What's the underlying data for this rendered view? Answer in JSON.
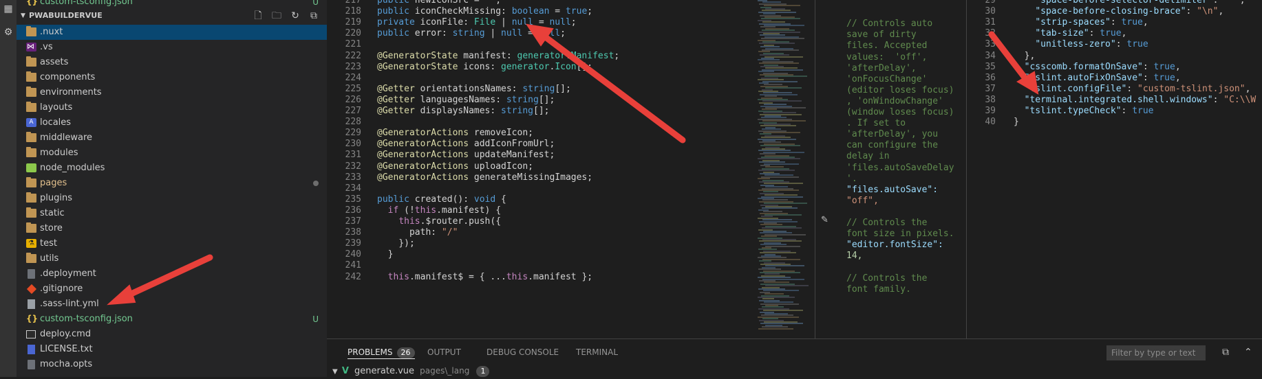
{
  "explorer": {
    "top_file": "custom-tsconfig.json",
    "top_file_badge": "U",
    "section_title": "PWABUILDERVUE",
    "items": [
      {
        "label": ".nuxt",
        "icon": "folder-icon",
        "selected": true
      },
      {
        "label": ".vs",
        "icon": "visual-studio-icon"
      },
      {
        "label": "assets",
        "icon": "folder-icon"
      },
      {
        "label": "components",
        "icon": "folder-icon"
      },
      {
        "label": "environments",
        "icon": "folder-icon"
      },
      {
        "label": "layouts",
        "icon": "folder-icon"
      },
      {
        "label": "locales",
        "icon": "locale-folder-icon"
      },
      {
        "label": "middleware",
        "icon": "folder-icon"
      },
      {
        "label": "modules",
        "icon": "folder-icon"
      },
      {
        "label": "node_modules",
        "icon": "node-folder-icon"
      },
      {
        "label": "pages",
        "icon": "folder-icon",
        "modified": true
      },
      {
        "label": "plugins",
        "icon": "folder-icon"
      },
      {
        "label": "static",
        "icon": "folder-icon"
      },
      {
        "label": "store",
        "icon": "folder-icon"
      },
      {
        "label": "test",
        "icon": "test-folder-icon"
      },
      {
        "label": "utils",
        "icon": "folder-icon"
      },
      {
        "label": ".deployment",
        "icon": "file-icon"
      },
      {
        "label": ".gitignore",
        "icon": "git-icon"
      },
      {
        "label": ".sass-lint.yml",
        "icon": "sass-icon"
      },
      {
        "label": "custom-tsconfig.json",
        "icon": "json-icon",
        "badge": "U"
      },
      {
        "label": "deploy.cmd",
        "icon": "cmd-icon"
      },
      {
        "label": "LICENSE.txt",
        "icon": "text-file-icon"
      },
      {
        "label": "mocha.opts",
        "icon": "file-icon"
      }
    ]
  },
  "editor1": {
    "lines": [
      {
        "n": "217",
        "t": "public newIconSrc = \"\";"
      },
      {
        "n": "218",
        "t": "public iconCheckMissing: boolean = true;"
      },
      {
        "n": "219",
        "t": "private iconFile: File | null = null;"
      },
      {
        "n": "220",
        "t": "public error: string | null = null;"
      },
      {
        "n": "221",
        "t": ""
      },
      {
        "n": "222",
        "t": "@GeneratorState manifest: generator.Manifest;"
      },
      {
        "n": "223",
        "t": "@GeneratorState icons: generator.Icon[];"
      },
      {
        "n": "224",
        "t": ""
      },
      {
        "n": "225",
        "t": "@Getter orientationsNames: string[];"
      },
      {
        "n": "226",
        "t": "@Getter languagesNames: string[];"
      },
      {
        "n": "227",
        "t": "@Getter displaysNames: string[];"
      },
      {
        "n": "228",
        "t": ""
      },
      {
        "n": "229",
        "t": "@GeneratorActions removeIcon;"
      },
      {
        "n": "230",
        "t": "@GeneratorActions addIconFromUrl;"
      },
      {
        "n": "231",
        "t": "@GeneratorActions updateManifest;"
      },
      {
        "n": "232",
        "t": "@GeneratorActions uploadIcon;"
      },
      {
        "n": "233",
        "t": "@GeneratorActions generateMissingImages;"
      },
      {
        "n": "234",
        "t": ""
      },
      {
        "n": "235",
        "t": "public created(): void {"
      },
      {
        "n": "236",
        "t": "  if (!this.manifest) {"
      },
      {
        "n": "237",
        "t": "    this.$router.push({"
      },
      {
        "n": "238",
        "t": "      path: \"/\""
      },
      {
        "n": "239",
        "t": "    });"
      },
      {
        "n": "240",
        "t": "  }"
      },
      {
        "n": "241",
        "t": ""
      },
      {
        "n": "242",
        "t": "  this.manifest$ = { ...this.manifest };"
      }
    ]
  },
  "editor2": {
    "lines": [
      "",
      "",
      "// Controls auto",
      "save of dirty",
      "files. Accepted",
      "values:  'off',",
      "'afterDelay',",
      "'onFocusChange'",
      "(editor loses focus)",
      ", 'onWindowChange'",
      "(window loses focus)",
      ". If set to",
      "'afterDelay', you",
      "can configure the",
      "delay in",
      "'files.autoSaveDelay",
      "'.",
      "\"files.autoSave\":",
      "\"off\",",
      "",
      "// Controls the",
      "font size in pixels.",
      "\"editor.fontSize\":",
      "14,",
      "",
      "// Controls the",
      "font family."
    ]
  },
  "editor3": {
    "lines": [
      {
        "n": "29",
        "t": "    \"space-before-selector-delimiter\": \" \","
      },
      {
        "n": "30",
        "t": "    \"space-before-closing-brace\": \"\\n\","
      },
      {
        "n": "31",
        "t": "    \"strip-spaces\": true,"
      },
      {
        "n": "32",
        "t": "    \"tab-size\": true,"
      },
      {
        "n": "33",
        "t": "    \"unitless-zero\": true"
      },
      {
        "n": "34",
        "t": "  },"
      },
      {
        "n": "35",
        "t": "  \"csscomb.formatOnSave\": true,"
      },
      {
        "n": "36",
        "t": "  \"tslint.autoFixOnSave\": true,"
      },
      {
        "n": "37",
        "t": "  \"tslint.configFile\": \"custom-tslint.json\","
      },
      {
        "n": "38",
        "t": "  \"terminal.integrated.shell.windows\": \"C:\\\\W"
      },
      {
        "n": "39",
        "t": "  \"tslint.typeCheck\": true"
      },
      {
        "n": "40",
        "t": "}"
      }
    ]
  },
  "panel": {
    "tabs": [
      {
        "label": "PROBLEMS",
        "count": "26",
        "active": true
      },
      {
        "label": "OUTPUT"
      },
      {
        "label": "DEBUG CONSOLE"
      },
      {
        "label": "TERMINAL"
      }
    ],
    "filter_placeholder": "Filter by type or text",
    "problem_file": "generate.vue",
    "problem_path": "pages\\_lang",
    "problem_count": "1"
  },
  "colors": {
    "accent": "#094771",
    "arrow": "#e8403a",
    "untracked": "#73c991"
  }
}
